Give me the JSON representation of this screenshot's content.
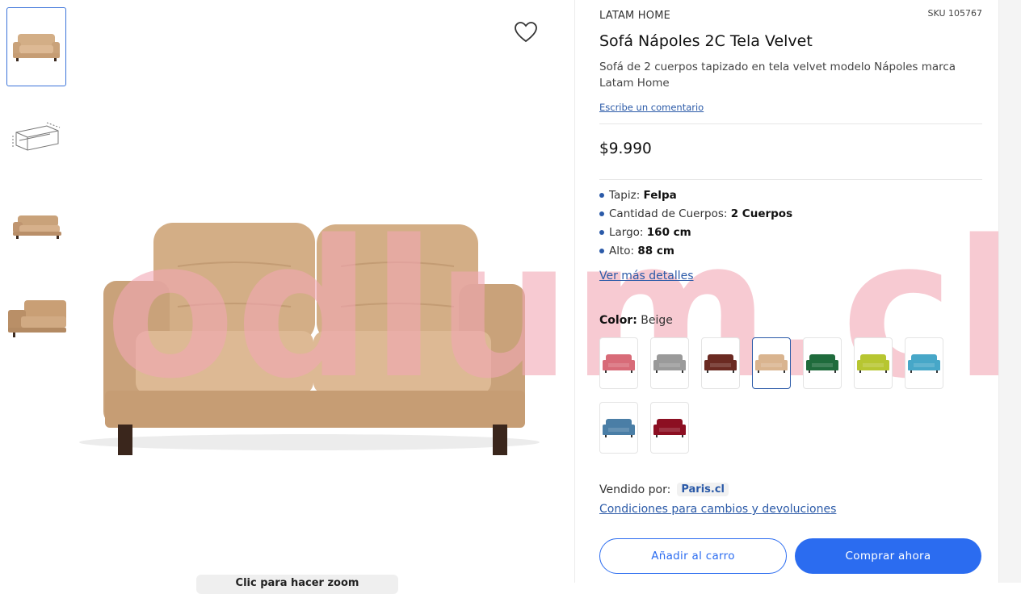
{
  "product": {
    "brand": "LATAM HOME",
    "sku": "SKU 105767",
    "title": "Sofá Nápoles 2C Tela Velvet",
    "description": "Sofá de 2 cuerpos tapizado en tela velvet modelo Nápoles marca Latam Home",
    "review_link": "Escribe un comentario",
    "price": "$9.990"
  },
  "specs": [
    {
      "label": "Tapiz:",
      "value": "Felpa"
    },
    {
      "label": "Cantidad de Cuerpos:",
      "value": "2 Cuerpos"
    },
    {
      "label": "Largo:",
      "value": "160 cm"
    },
    {
      "label": "Alto:",
      "value": "88 cm"
    }
  ],
  "more_details": "Ver más detalles",
  "color": {
    "label": "Color:",
    "selected": "Beige",
    "swatches": [
      "#d86b78",
      "#9a9a9a",
      "#6b2a22",
      "#d9b48f",
      "#1f6b3c",
      "#b7c631",
      "#47a7c8",
      "#4a7ea6",
      "#8c0f22"
    ]
  },
  "seller": {
    "label": "Vendido por:",
    "name": "Paris.cl"
  },
  "conditions_link": "Condiciones para cambios y devoluciones",
  "buttons": {
    "add_to_cart": "Añadir al carro",
    "buy_now": "Comprar ahora"
  },
  "zoom_hint": "Clic para hacer zoom",
  "watermark": "odlum.cl",
  "colors": {
    "accent": "#2b6cf0",
    "link": "#2b5aa8",
    "sofa": "#d9b48f",
    "watermark": "#f2a6b4"
  }
}
